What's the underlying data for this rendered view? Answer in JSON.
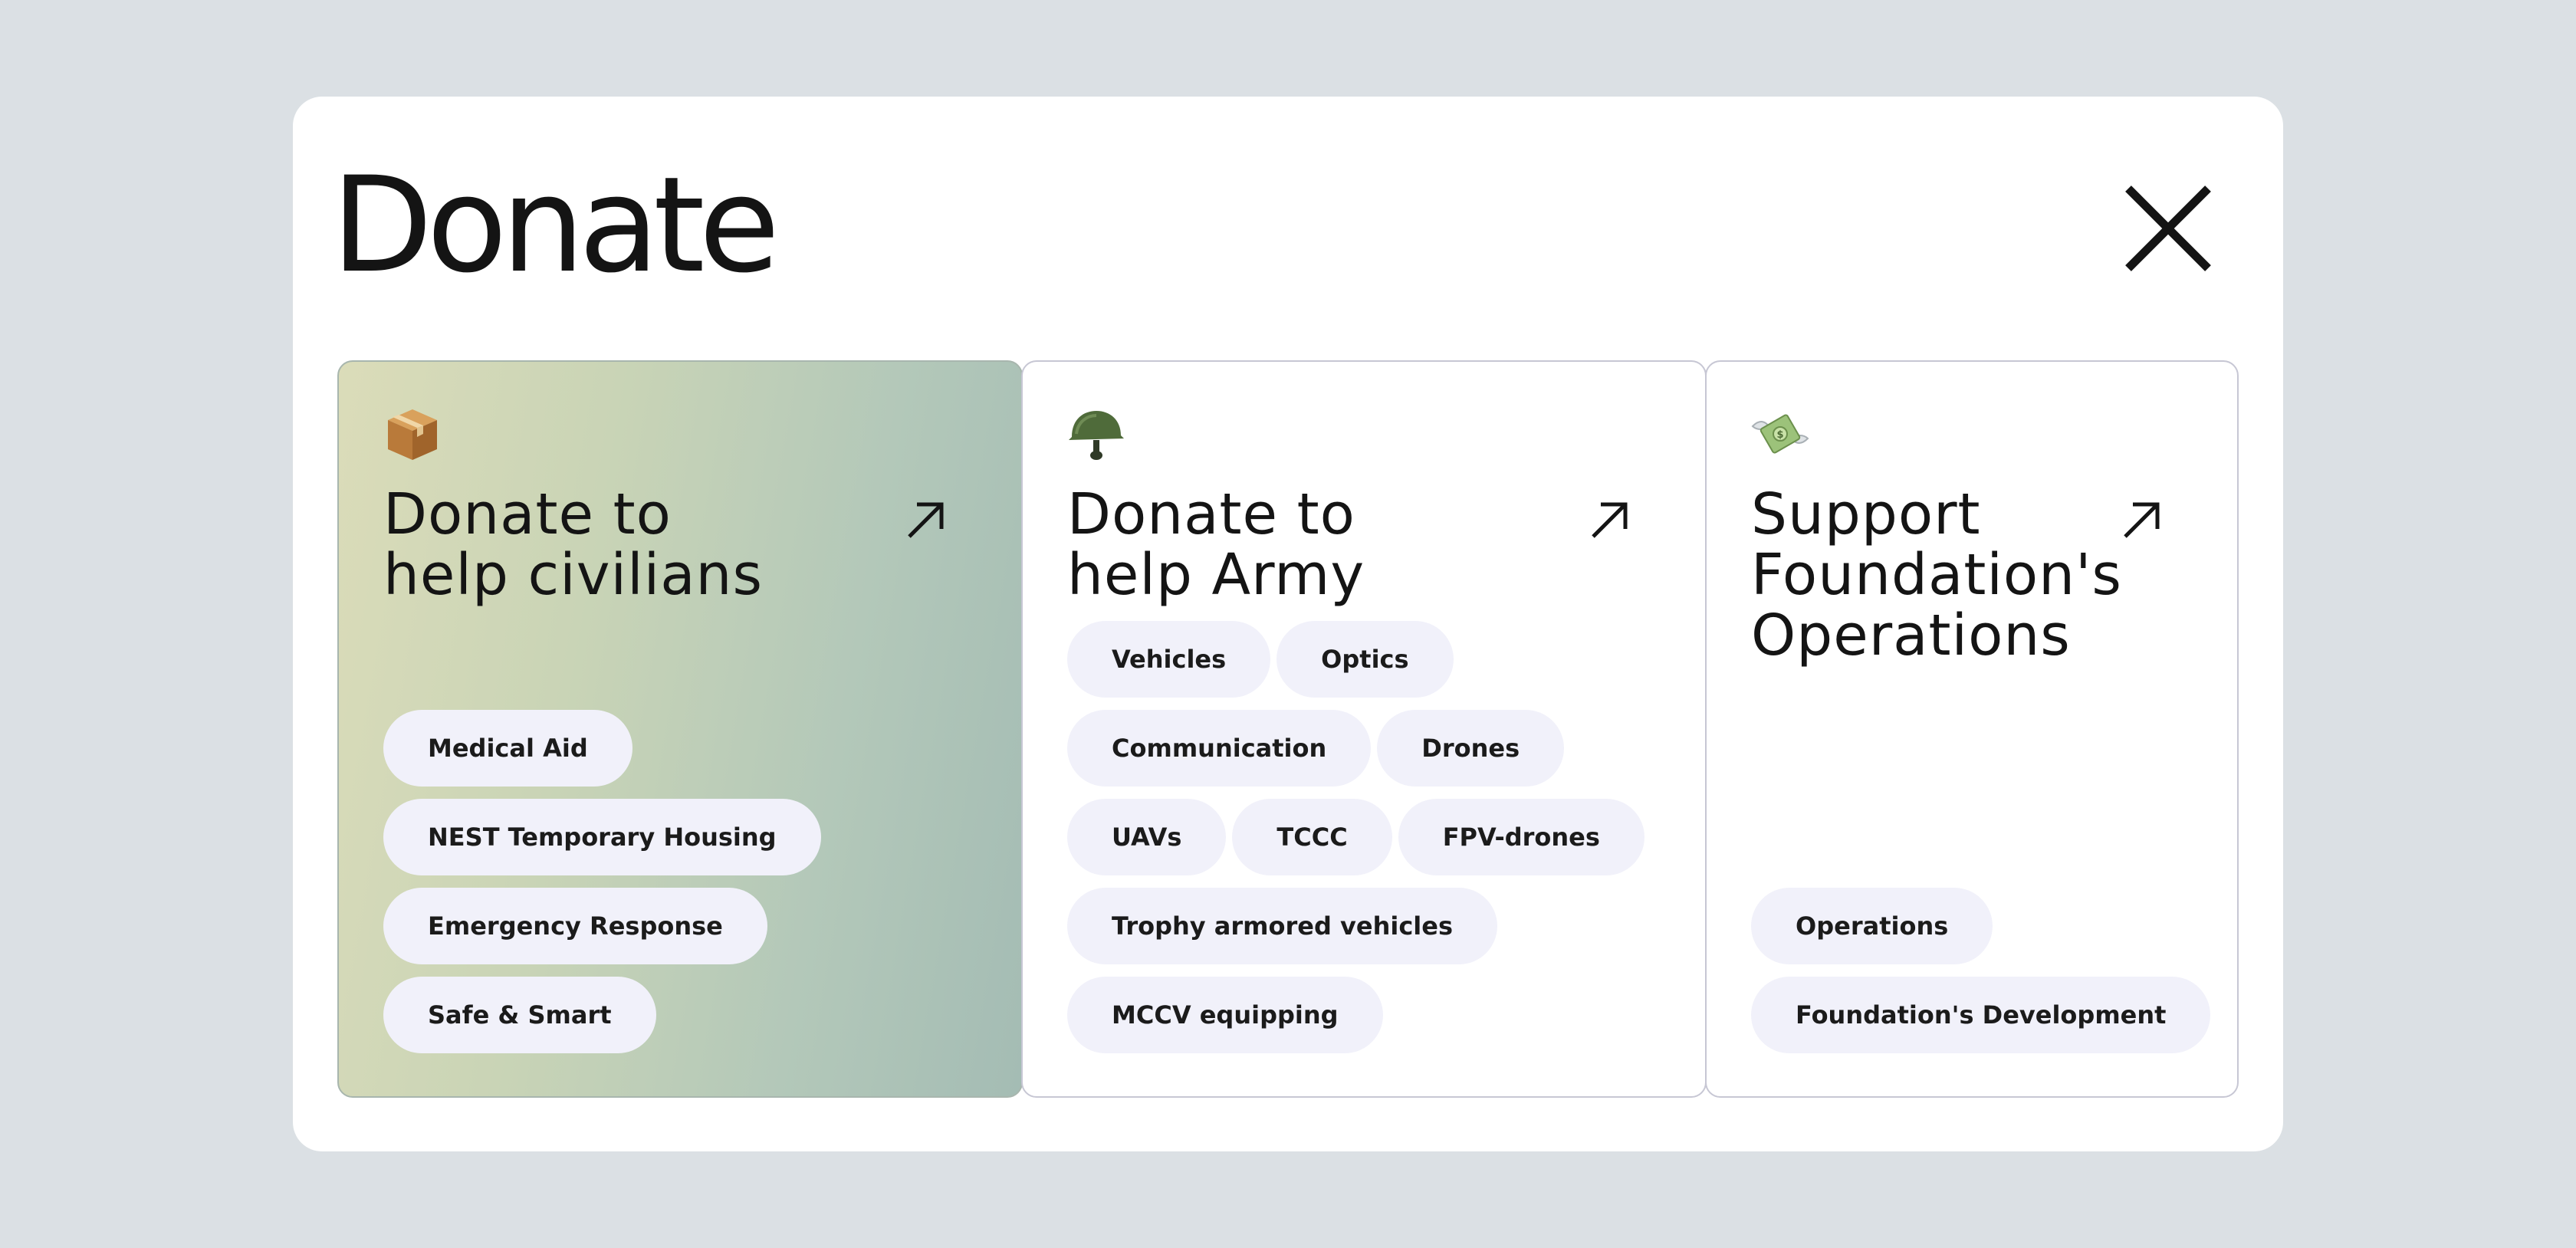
{
  "modal": {
    "title": "Donate",
    "close_icon": "close-x-icon"
  },
  "cards": [
    {
      "icon": "package-box-emoji",
      "title": "Donate to\nhelp civilians",
      "arrow_icon": "arrow-up-right-icon",
      "tags": [
        "Medical Aid",
        "NEST Temporary Housing",
        "Emergency Response",
        "Safe & Smart"
      ]
    },
    {
      "icon": "military-helmet-emoji",
      "title": "Donate to\nhelp Army",
      "arrow_icon": "arrow-up-right-icon",
      "tags": [
        "Vehicles",
        "Optics",
        "Communication",
        "Drones",
        "UAVs",
        "TCCC",
        "FPV-drones",
        "Trophy armored vehicles",
        "MCCV equipping"
      ]
    },
    {
      "icon": "money-with-wings-emoji",
      "title": "Support\nFoundation's\nOperations",
      "arrow_icon": "arrow-up-right-icon",
      "tags": [
        "Operations",
        "Foundation's Development"
      ]
    }
  ],
  "colors": {
    "page_background": "#dbe0e4",
    "modal_background": "#ffffff",
    "tag_background": "#f1f1fa",
    "text": "#141414",
    "civilians_gradient_start": "#dbdcb9",
    "civilians_gradient_end": "#a4bcb4"
  }
}
